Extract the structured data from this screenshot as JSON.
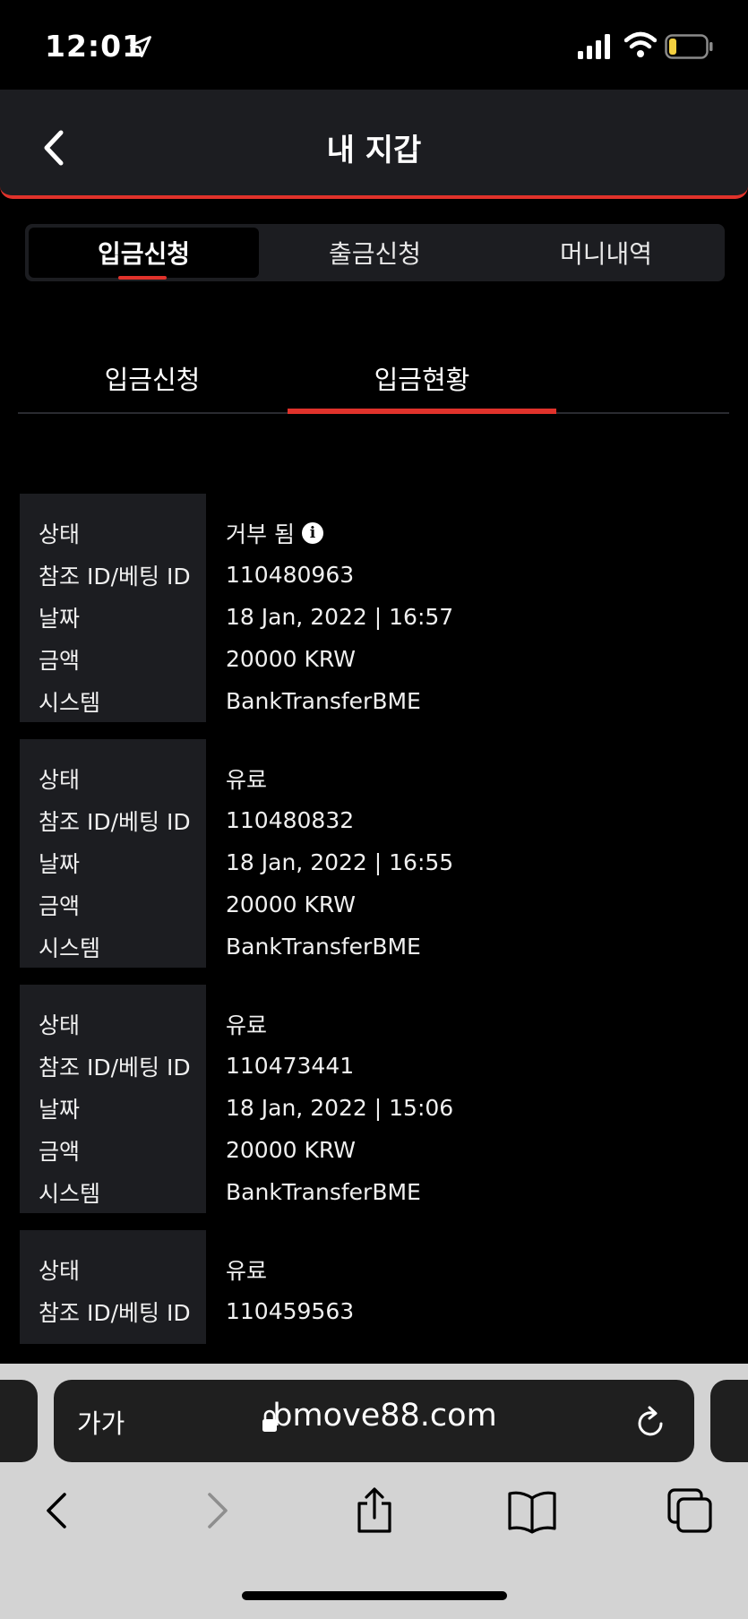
{
  "status_bar": {
    "time": "12:01"
  },
  "header": {
    "title": "내 지갑"
  },
  "segment_tabs": [
    {
      "label": "입금신청",
      "active": true
    },
    {
      "label": "출금신청",
      "active": false
    },
    {
      "label": "머니내역",
      "active": false
    }
  ],
  "sub_tabs": [
    {
      "label": "입금신청",
      "active": false
    },
    {
      "label": "입금현황",
      "active": true
    }
  ],
  "records": [
    {
      "rows": [
        {
          "label": "상태",
          "value": "거부 됨",
          "info": true
        },
        {
          "label": "참조 ID/베팅 ID",
          "value": "110480963"
        },
        {
          "label": "날짜",
          "value": "18 Jan, 2022 | 16:57"
        },
        {
          "label": "금액",
          "value": "20000 KRW"
        },
        {
          "label": "시스템",
          "value": "BankTransferBME"
        }
      ]
    },
    {
      "rows": [
        {
          "label": "상태",
          "value": "유료"
        },
        {
          "label": "참조 ID/베팅 ID",
          "value": "110480832"
        },
        {
          "label": "날짜",
          "value": "18 Jan, 2022 | 16:55"
        },
        {
          "label": "금액",
          "value": "20000 KRW"
        },
        {
          "label": "시스템",
          "value": "BankTransferBME"
        }
      ]
    },
    {
      "rows": [
        {
          "label": "상태",
          "value": "유료"
        },
        {
          "label": "참조 ID/베팅 ID",
          "value": "110473441"
        },
        {
          "label": "날짜",
          "value": "18 Jan, 2022 | 15:06"
        },
        {
          "label": "금액",
          "value": "20000 KRW"
        },
        {
          "label": "시스템",
          "value": "BankTransferBME"
        }
      ]
    },
    {
      "rows": [
        {
          "label": "상태",
          "value": "유료"
        },
        {
          "label": "참조 ID/베팅 ID",
          "value": "110459563"
        }
      ]
    }
  ],
  "browser": {
    "text_size_label": "가가",
    "url": "bmove88.com"
  },
  "colors": {
    "accent": "#e0322b",
    "panel": "#1c1d21",
    "background": "#000000"
  }
}
